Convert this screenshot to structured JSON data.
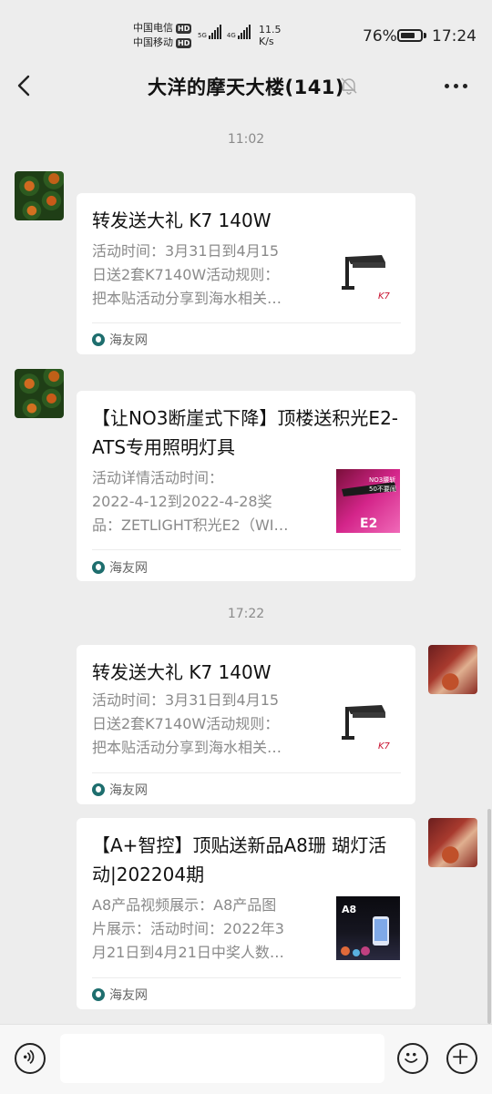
{
  "status_bar": {
    "carrier1": "中国电信",
    "carrier2": "中国移动",
    "hd_badge": "HD",
    "net1": "5G",
    "net2": "4G",
    "speed_value": "11.5",
    "speed_unit": "K/s",
    "battery_percent": "76%",
    "battery_level": 0.76,
    "time": "17:24"
  },
  "header": {
    "title": "大洋的摩天大楼(141)",
    "back_icon": "chevron-left-icon",
    "mute_icon": "bell-off-icon",
    "more_icon": "more-dots-icon"
  },
  "chat": {
    "time1": "11:02",
    "time2": "17:22",
    "messages": [
      {
        "sender": "other",
        "title": "转发送大礼 K7 140W",
        "desc": [
          "活动时间：3月31日到4月15",
          "日送2套K7140W活动规则：",
          "把本贴活动分享到海水相关…"
        ],
        "thumb_text": "K7",
        "source": "海友网"
      },
      {
        "sender": "other",
        "title": "【让NO3断崖式下降】顶楼送积光E2-ATS专用照明灯具",
        "desc": [
          "活动详情活动时间：",
          "2022-4-12到2022-4-28奖",
          "品：ZETLIGHT积光E2（WI…"
        ],
        "thumb_text_top": "NO3腰斩",
        "thumb_text_mid": "50不要闹",
        "thumb_text_bottom": "E2",
        "source": "海友网"
      },
      {
        "sender": "self",
        "title": "转发送大礼 K7 140W",
        "desc": [
          "活动时间：3月31日到4月15",
          "日送2套K7140W活动规则：",
          "把本贴活动分享到海水相关…"
        ],
        "thumb_text": "K7",
        "source": "海友网"
      },
      {
        "sender": "self",
        "title": "【A+智控】顶贴送新品A8珊 瑚灯活动|202204期",
        "desc": [
          "A8产品视频展示：A8产品图",
          "片展示：活动时间：2022年3",
          "月21日到4月21日中奖人数…"
        ],
        "thumb_text": "A8",
        "source": "海友网"
      }
    ]
  },
  "input_bar": {
    "voice_icon": "voice-icon",
    "emoji_icon": "emoji-icon",
    "add_icon": "plus-circle-icon",
    "input_value": ""
  }
}
